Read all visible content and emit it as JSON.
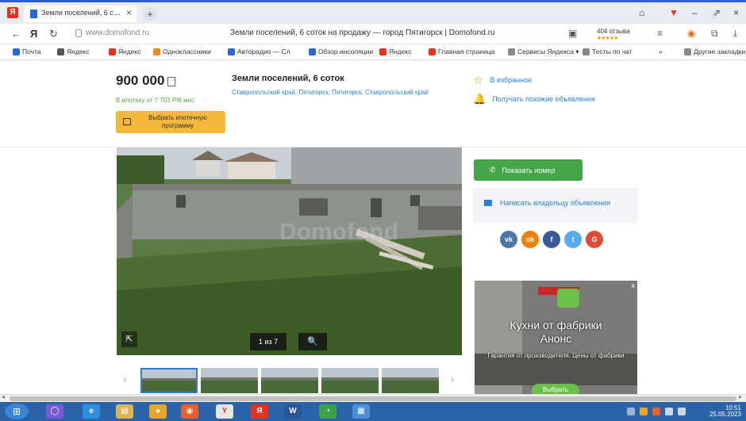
{
  "browser": {
    "tab_title": "Земли поселений, 6 с…",
    "tab_close": "×",
    "new_tab": "+",
    "yandex_logo": "Я",
    "url": "www.domofond.ru",
    "page_title": "Земли поселений, 6 соток на продажу — город Пятигорск | Domofond.ru",
    "reviews_label": "404 отзыва",
    "reviews_stars": "★★★★★",
    "window_controls": [
      "⌂",
      "▼",
      "–",
      "⇗",
      "×"
    ],
    "address_icons": [
      "▣",
      "≡",
      "◉",
      "⧉",
      "⤓"
    ]
  },
  "bookmarks": [
    {
      "label": "Почта",
      "color": "#2c67d8"
    },
    {
      "label": "Яндекс",
      "color": "#555555"
    },
    {
      "label": "Яндекс",
      "color": "#e6321e"
    },
    {
      "label": "Одноклассники",
      "color": "#f08a1c"
    },
    {
      "label": "Авторадио — Сл",
      "color": "#2c67d8"
    },
    {
      "label": "Oбзор инсоляции",
      "color": "#2c67d8"
    },
    {
      "label": "Яндекс",
      "color": "#e6321e"
    },
    {
      "label": "Главная страница",
      "color": "#e6321e"
    },
    {
      "label": "Сервисы Яндекса ▾",
      "color": "#888888"
    },
    {
      "label": "Тесты по чат",
      "color": "#888888"
    },
    {
      "label": "»",
      "color": "#ffffff"
    },
    {
      "label": "Другие закладки ▾",
      "color": "#888888"
    }
  ],
  "listing": {
    "price": "900 000",
    "mortgage_text": "В ипотеку от 7 703 Р/6 мес",
    "mortgage_button": "Выбрать ипотечную программу",
    "title": "Земли поселений, 6 соток",
    "address": "Ставропольский край, Пятигорск, Пятигорск, Ставропольский край",
    "favorite": "В избранное",
    "notify": "Получать похожие объявления",
    "watermark": "Domofond",
    "photo_counter": "1 из 7",
    "zoom_icon": "🔍",
    "expand_icon": "⇱",
    "prev_arrow": "‹",
    "next_arrow": "›"
  },
  "contact": {
    "show_phone": "Показать номер",
    "phone_icon": "✆",
    "write_owner": "Написать владельцу объявления",
    "social": [
      {
        "label": "vk",
        "color": "#4a76a8"
      },
      {
        "label": "ok",
        "color": "#ee8208"
      },
      {
        "label": "f",
        "color": "#3b5998"
      },
      {
        "label": "t",
        "color": "#55acee"
      },
      {
        "label": "G",
        "color": "#dd4b39"
      }
    ]
  },
  "ad": {
    "close": "x",
    "headline_1": "Кухни от фабрики",
    "headline_2": "Анонс",
    "subtext": "Гарантия от производителя. Цены от фабрики",
    "cta": "Выбрать"
  },
  "taskbar": {
    "start": "⊞",
    "icons": [
      {
        "label": "◯",
        "color": "#7a5bd6"
      },
      {
        "label": "e",
        "color": "#2c8fe0"
      },
      {
        "label": "▤",
        "color": "#d9b45a"
      },
      {
        "label": "●",
        "color": "#e8a52a"
      },
      {
        "label": "◉",
        "color": "#e8602a"
      },
      {
        "label": "Y",
        "color": "#e6e6e6"
      },
      {
        "label": "Я",
        "color": "#e6321e"
      },
      {
        "label": "W",
        "color": "#2b579a"
      },
      {
        "label": "◔",
        "color": "#3aa34a"
      },
      {
        "label": "▦",
        "color": "#4a90d9"
      }
    ],
    "time": "10:51",
    "date": "25.05.2023"
  },
  "colors": {
    "accent_blue": "#2d7fd0",
    "green_button": "#44a649",
    "mortgage_yellow": "#f4b93a"
  }
}
